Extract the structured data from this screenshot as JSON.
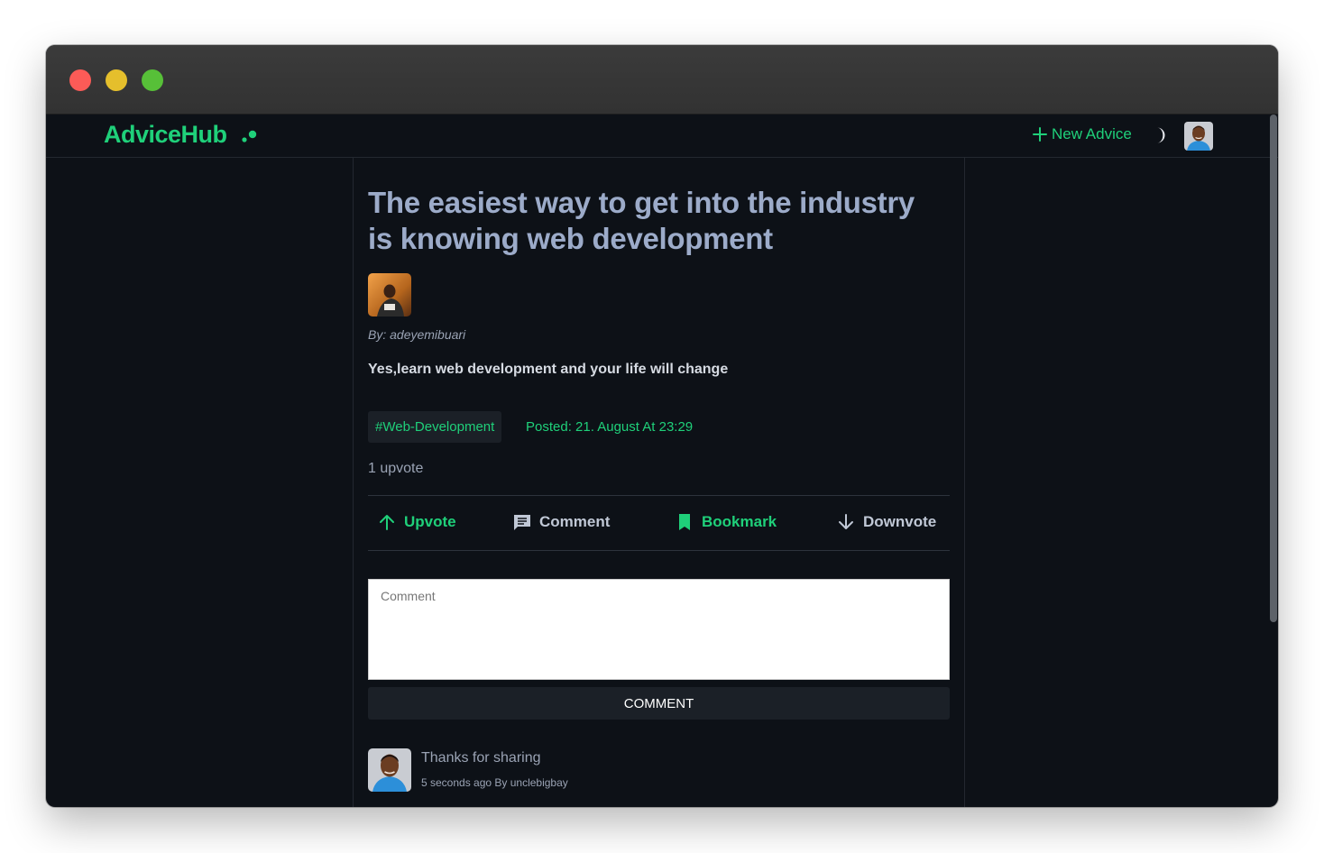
{
  "app": {
    "logo": "AdviceHub",
    "brand_color": "#1fd07a"
  },
  "navbar": {
    "new_advice_label": "New Advice",
    "theme_toggle_icon": "moon-icon",
    "avatar_icon": "user-avatar"
  },
  "post": {
    "title": "The easiest way to get into the industry is knowing web development",
    "byline": "By: adeyemibuari",
    "body": "Yes,learn web development and your life will change",
    "tag": "#Web-Development",
    "posted": "Posted: 21. August At 23:29",
    "upvote_count": "1 upvote"
  },
  "actions": {
    "upvote": "Upvote",
    "comment": "Comment",
    "bookmark": "Bookmark",
    "downvote": "Downvote"
  },
  "comment_form": {
    "placeholder": "Comment",
    "value": "",
    "button": "COMMENT"
  },
  "comments": [
    {
      "text": "Thanks for sharing",
      "meta": "5 seconds ago By unclebigbay"
    }
  ]
}
